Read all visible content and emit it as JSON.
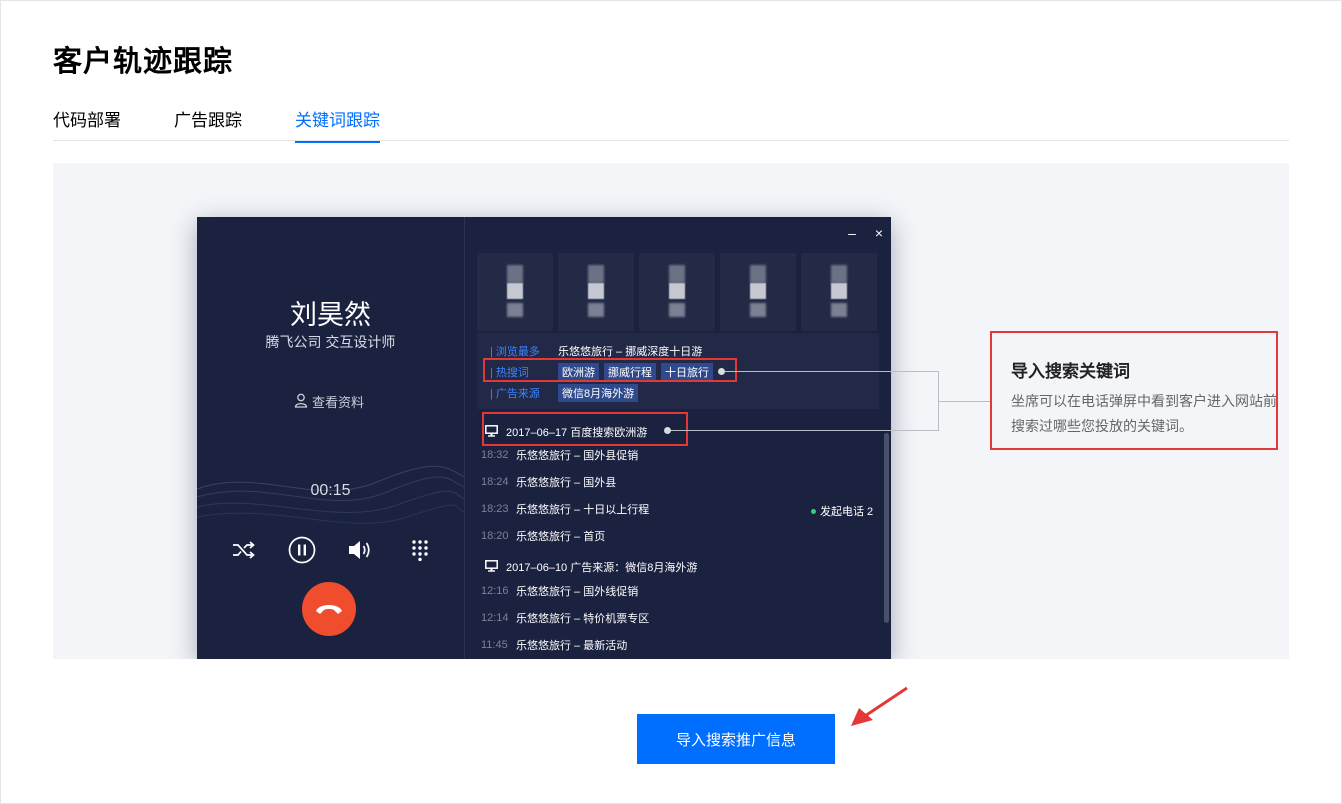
{
  "page": {
    "title": "客户轨迹跟踪"
  },
  "tabs": [
    {
      "label": "代码部署",
      "active": false
    },
    {
      "label": "广告跟踪",
      "active": false
    },
    {
      "label": "关键词跟踪",
      "active": true
    }
  ],
  "phone": {
    "caller_name": "刘昊然",
    "caller_title": "腾飞公司 交互设计师",
    "view_profile": "查看资料",
    "timer": "00:15",
    "window_controls": {
      "minimize": "–",
      "close": "×"
    },
    "info": {
      "most_viewed_label": "| 浏览最多",
      "most_viewed_value": "乐悠悠旅行 – 挪威深度十日游",
      "hot_search_label": "| 热搜词",
      "hot_search_chips": [
        "欧洲游",
        "挪威行程",
        "十日旅行"
      ],
      "ad_source_label": "| 广告来源",
      "ad_source_chip": "微信8月海外游"
    },
    "sessions": [
      {
        "header": "2017–06–17  百度搜索欧洲游",
        "rows": [
          {
            "time": "18:32",
            "text": "乐悠悠旅行 – 国外县促销"
          },
          {
            "time": "18:24",
            "text": "乐悠悠旅行 – 国外县"
          },
          {
            "time": "18:23",
            "text": "乐悠悠旅行 – 十日以上行程"
          },
          {
            "time": "18:20",
            "text": "乐悠悠旅行 – 首页"
          }
        ]
      },
      {
        "header": "2017–06–10  广告来源：微信8月海外游",
        "rows": [
          {
            "time": "12:16",
            "text": "乐悠悠旅行 – 国外线促销"
          },
          {
            "time": "12:14",
            "text": "乐悠悠旅行 – 特价机票专区"
          },
          {
            "time": "11:45",
            "text": "乐悠悠旅行 – 最新活动"
          }
        ]
      }
    ],
    "call_tag": "发起电话 2"
  },
  "callout": {
    "title": "导入搜索关键词",
    "description": "坐席可以在电话弹屏中看到客户进入网站前搜索过哪些您投放的关键词。"
  },
  "import_button": {
    "label": "导入搜索推广信息"
  },
  "colors": {
    "accent": "#006eff",
    "highlight": "#e43737",
    "hangup": "#f04d2e",
    "popup_bg": "#1b2240"
  }
}
